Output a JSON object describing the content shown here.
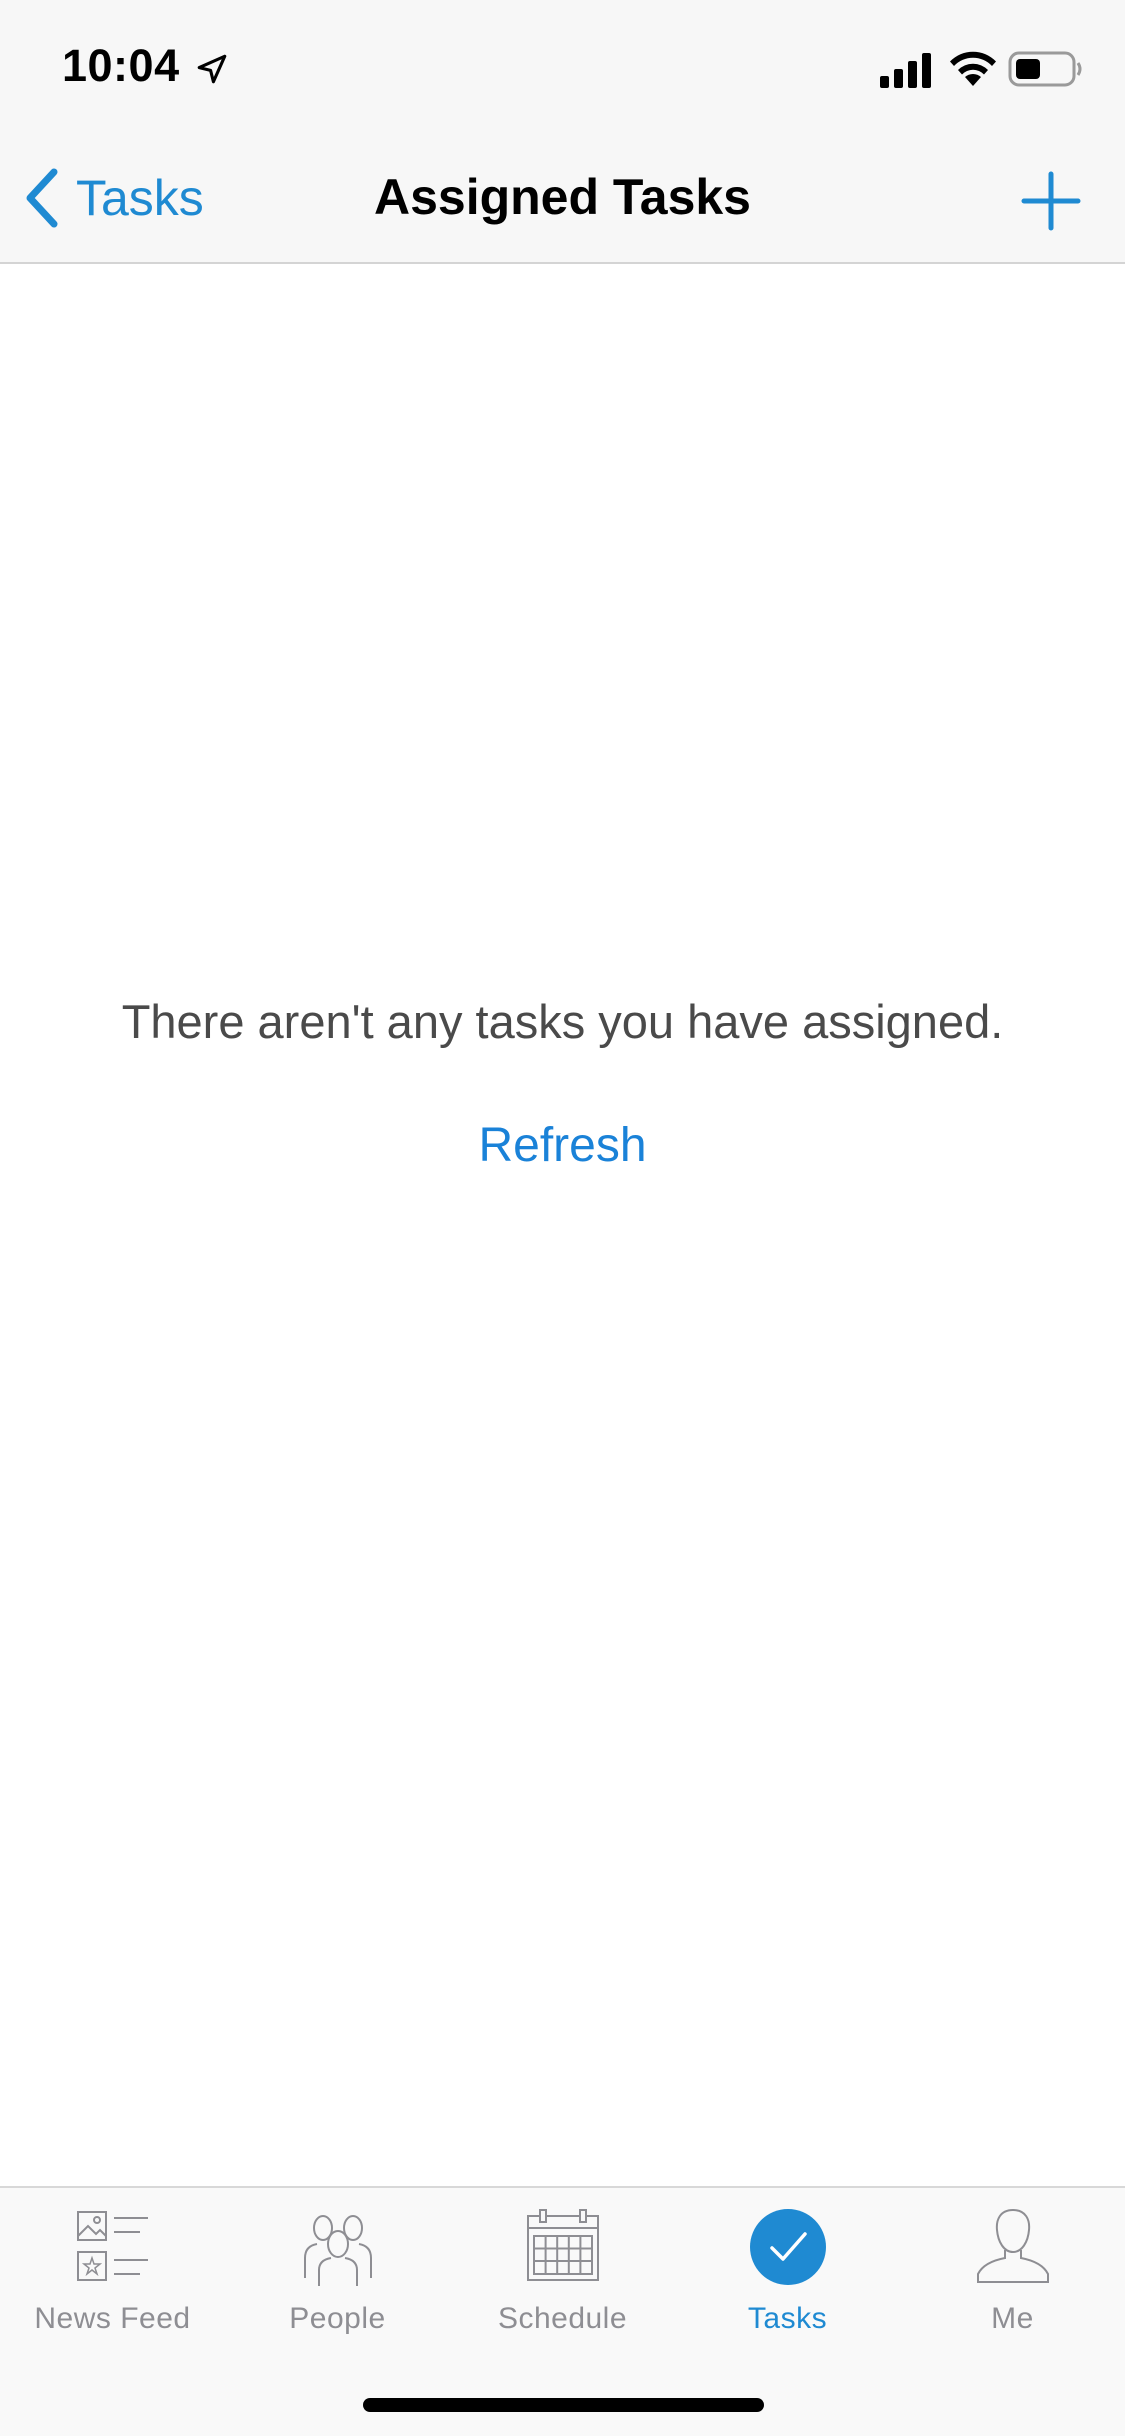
{
  "status_bar": {
    "time": "10:04"
  },
  "nav": {
    "back_label": "Tasks",
    "title": "Assigned Tasks",
    "add_icon": "plus-icon"
  },
  "empty_state": {
    "message": "There aren't any tasks you have assigned.",
    "refresh_label": "Refresh"
  },
  "tab_bar": {
    "active_tab": "Tasks",
    "tabs": [
      {
        "label": "News Feed",
        "icon": "news-feed-icon"
      },
      {
        "label": "People",
        "icon": "people-icon"
      },
      {
        "label": "Schedule",
        "icon": "calendar-icon"
      },
      {
        "label": "Tasks",
        "icon": "check-circle-icon"
      },
      {
        "label": "Me",
        "icon": "person-icon"
      }
    ]
  },
  "colors": {
    "accent": "#1f8ad2",
    "link": "#1a82d8",
    "inactive_tab": "#8e8e93",
    "bar_background": "#f7f7f7"
  }
}
